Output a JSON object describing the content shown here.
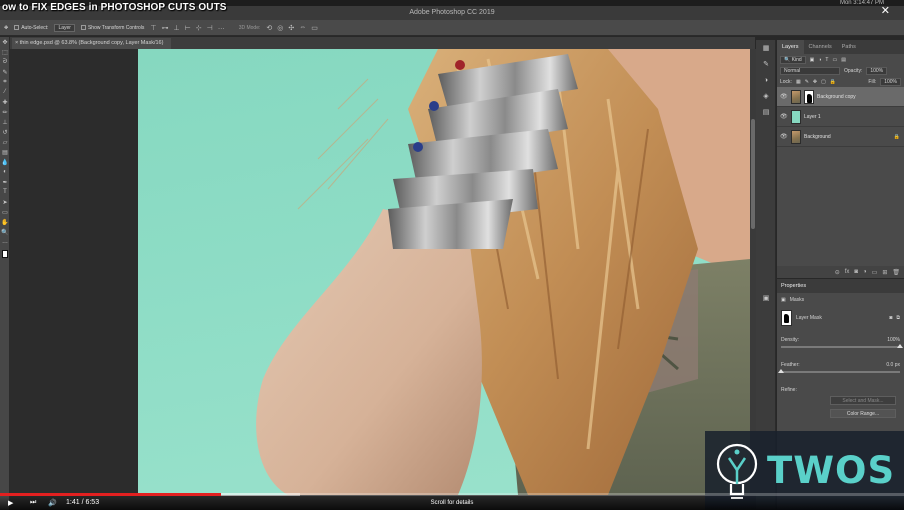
{
  "video": {
    "title": "ow to FIX EDGES in PHOTOSHOP CUTS OUTS",
    "time_current": "1:41",
    "time_total": "6:53",
    "scroll_hint": "Scroll for details",
    "progress_fraction": 0.245
  },
  "system": {
    "clock": "Mon 3:14:47 PM"
  },
  "app": {
    "title": "Adobe Photoshop CC 2019"
  },
  "options": {
    "auto_select_label": "Auto-Select:",
    "auto_select_value": "Layer",
    "transform_label": "Show Transform Controls",
    "mode_3d_label": "3D Mode:"
  },
  "document": {
    "tab_label": "thin edge.psd @ 63.8% (Background copy, Layer Mask/16)"
  },
  "layers_panel": {
    "tabs": [
      "Layers",
      "Channels",
      "Paths"
    ],
    "kind_label": "Kind",
    "blend_mode": "Normal",
    "opacity_label": "Opacity:",
    "opacity_value": "100%",
    "lock_label": "Lock:",
    "fill_label": "Fill:",
    "fill_value": "100%",
    "layers": [
      {
        "name": "Background copy"
      },
      {
        "name": "Layer 1"
      },
      {
        "name": "Background"
      }
    ]
  },
  "properties": {
    "title": "Properties",
    "section": "Masks",
    "mask_name": "Layer Mask",
    "density_label": "Density:",
    "density_value": "100%",
    "feather_label": "Feather:",
    "feather_value": "0.0 px",
    "refine_label": "Refine:",
    "select_mask_button": "Select and Mask...",
    "color_range_button": "Color Range..."
  },
  "watermark": {
    "text": "TWOS"
  },
  "colors": {
    "canvas_bg": "#86d8c0",
    "progress_red": "#e32020",
    "watermark_teal": "#5ad0c9"
  }
}
